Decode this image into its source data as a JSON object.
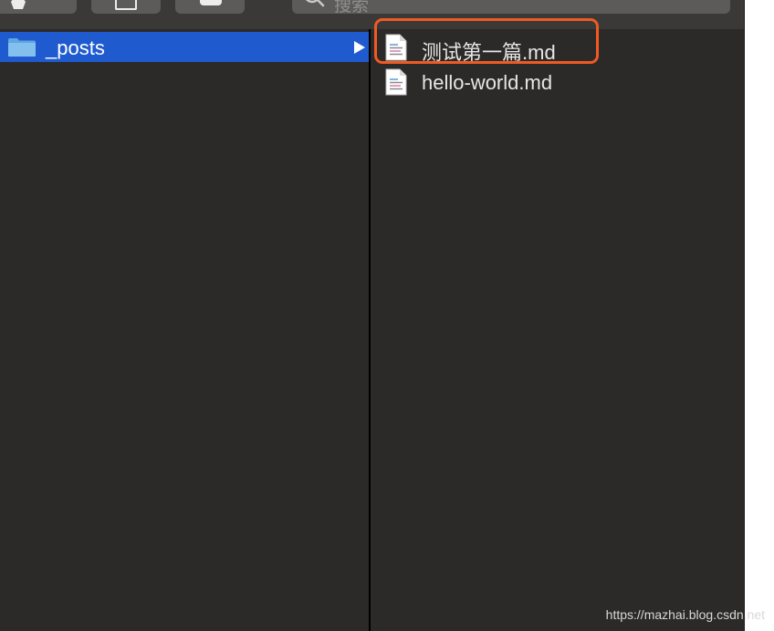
{
  "search": {
    "placeholder": "搜索"
  },
  "columns": {
    "first": {
      "items": [
        {
          "label": "_posts",
          "type": "folder",
          "selected": true,
          "icon": "folder-icon"
        }
      ]
    },
    "second": {
      "items": [
        {
          "label": "测试第一篇.md",
          "type": "file",
          "icon": "document-icon",
          "highlighted": true
        },
        {
          "label": "hello-world.md",
          "type": "file",
          "icon": "document-icon"
        }
      ]
    }
  },
  "toolbar": {
    "icons": [
      "gear-icon",
      "share-icon",
      "tag-icon",
      "search-icon"
    ]
  },
  "colors": {
    "selection": "#1f5bcf",
    "highlight_border": "#f05a22",
    "background": "#2b2a29"
  },
  "watermark": "https://mazhai.blog.csdn.net"
}
